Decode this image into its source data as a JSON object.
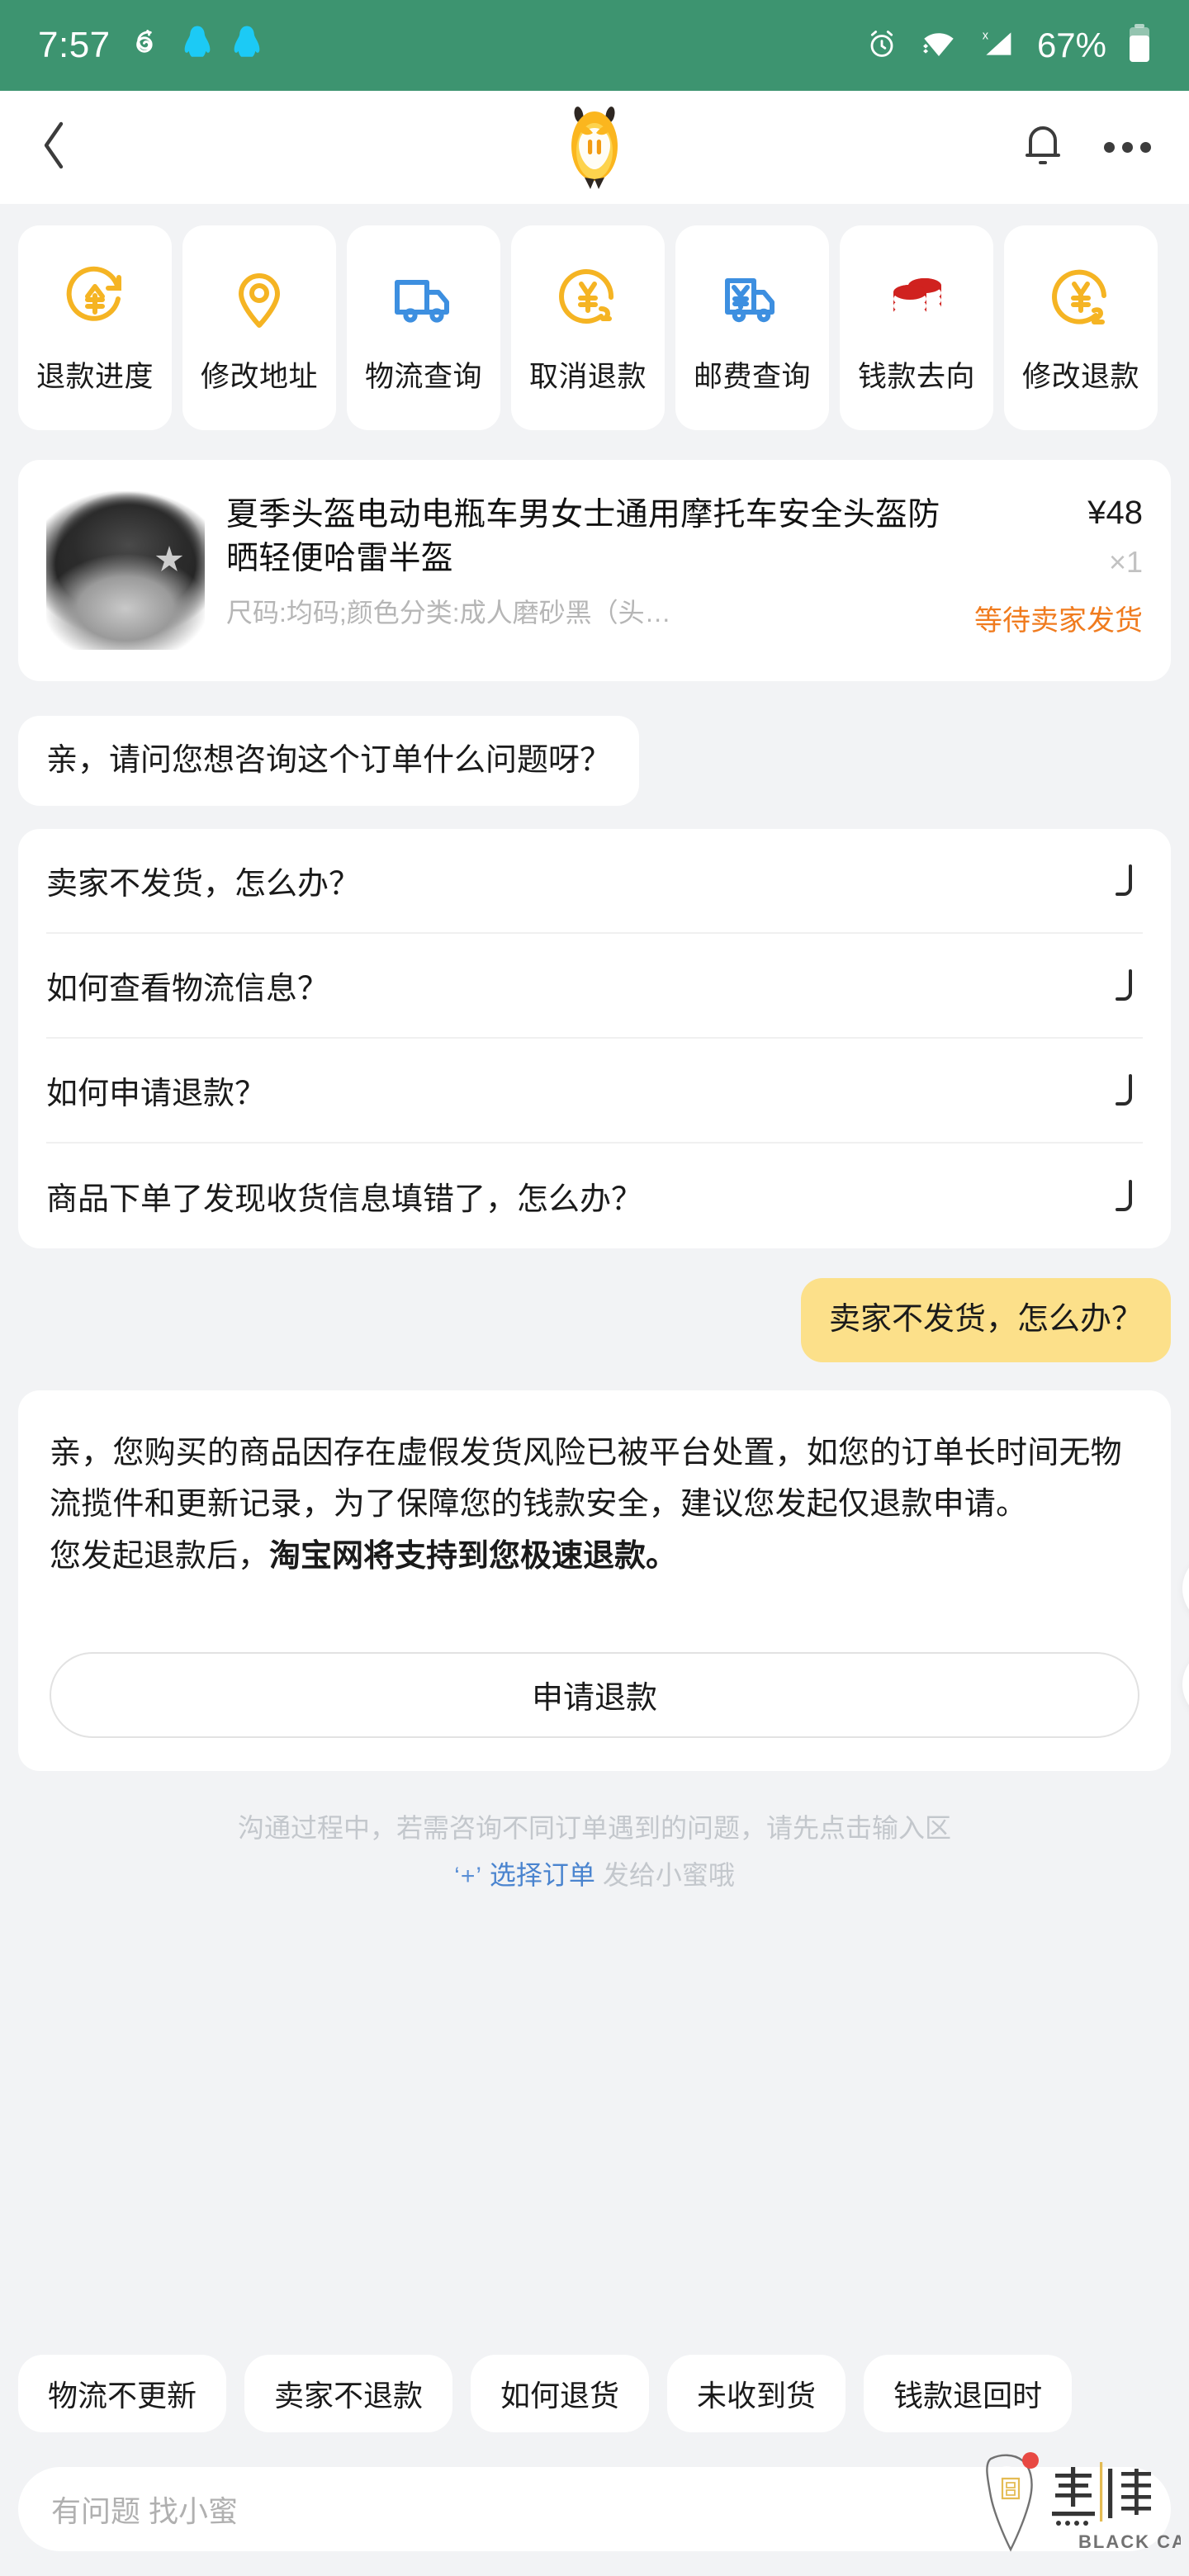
{
  "status_bar": {
    "time": "7:57",
    "battery_text": "67%",
    "icons": [
      "netease-music-icon",
      "qq-icon",
      "qq-icon",
      "alarm-icon",
      "wifi-icon",
      "signal-no-sim-icon",
      "battery-icon"
    ],
    "background_color": "#3D9470"
  },
  "nav_bar": {
    "back_icon": "chevron-left-icon",
    "logo_icon": "taobao-xiaomi-mascot-icon",
    "bell_icon": "bell-icon",
    "more_icon": "more-horizontal-icon"
  },
  "quick_actions": [
    {
      "label": "退款进度",
      "icon": "refund-progress-icon",
      "color": "#F5B423"
    },
    {
      "label": "修改地址",
      "icon": "location-pin-icon",
      "color": "#F5B423"
    },
    {
      "label": "物流查询",
      "icon": "truck-icon",
      "color": "#3D8FE0"
    },
    {
      "label": "取消退款",
      "icon": "cancel-refund-icon",
      "color": "#F5B423"
    },
    {
      "label": "邮费查询",
      "icon": "shipping-fee-truck-icon",
      "color": "#3D8FE0"
    },
    {
      "label": "钱款去向",
      "icon": "coins-stack-icon",
      "color": "#D0221F"
    },
    {
      "label": "修改退款",
      "icon": "edit-refund-icon",
      "color": "#F5B423"
    }
  ],
  "product": {
    "image_icon": "motorcycle-helmet-photo",
    "title": "夏季头盔电动电瓶车男女士通用摩托车安全头盔防晒轻便哈雷半盔",
    "sku": "尺码:均码;颜色分类:成人磨砂黑（头…",
    "price": "¥48",
    "quantity": "×1",
    "status": "等待卖家发货",
    "status_color": "#F07B1E"
  },
  "chat": {
    "bot_greeting": "亲，请问您想咨询这个订单什么问题呀？",
    "faq_items": [
      {
        "label": "卖家不发货，怎么办？",
        "icon": "return-arrow-icon"
      },
      {
        "label": "如何查看物流信息？",
        "icon": "return-arrow-icon"
      },
      {
        "label": "如何申请退款？",
        "icon": "return-arrow-icon"
      },
      {
        "label": "商品下单了发现收货信息填错了，怎么办？",
        "icon": "return-arrow-icon"
      }
    ],
    "user_message": "卖家不发货，怎么办？",
    "user_bubble_color": "#FCE08A",
    "answer": {
      "paragraph1": "亲，您购买的商品因存在虚假发货风险已被平台处置，如您的订单长时间无物流揽件和更新记录，为了保障您的钱款安全，建议您发起仅退款申请。",
      "paragraph2_prefix": "您发起退款后，",
      "paragraph2_bold": "淘宝网将支持到您极速退款。",
      "action_button": "申请退款"
    },
    "feedback": [
      {
        "icon": "thumbs-up-icon"
      },
      {
        "icon": "thumbs-down-icon"
      }
    ]
  },
  "hint": {
    "line1": "沟通过程中，若需咨询不同订单遇到的问题，请先点击输入区",
    "plus": "‘+’",
    "link": "选择订单",
    "line2_suffix": "发给小蜜哦"
  },
  "quick_replies": [
    "物流不更新",
    "卖家不退款",
    "如何退货",
    "未收到货",
    "钱款退回时"
  ],
  "input_bar": {
    "placeholder": "有问题 找小蜜"
  },
  "watermark": {
    "brand": "黑猫",
    "sub": "BLACK CAT"
  }
}
